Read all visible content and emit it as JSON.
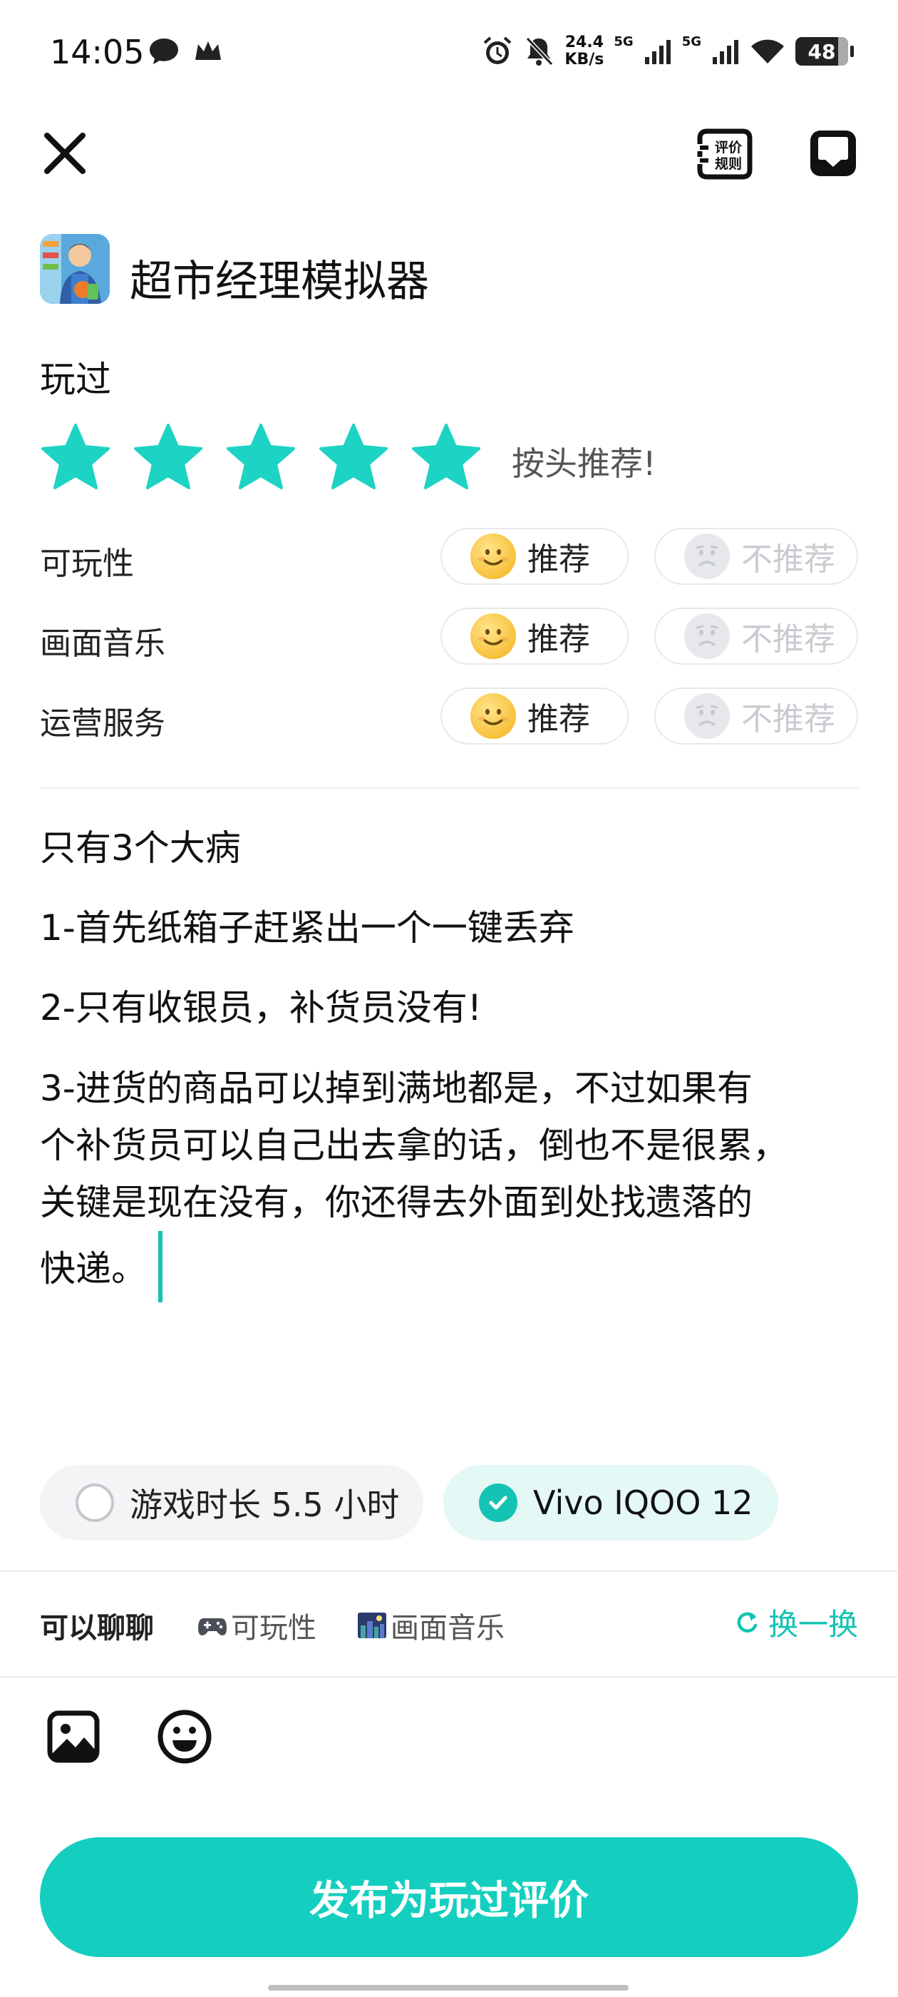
{
  "status_bar": {
    "time": "14:05",
    "net_speed_top": "24.4",
    "net_speed_bottom": "KB/s",
    "sim1": "5G",
    "sim2": "5G",
    "battery": "48"
  },
  "header": {
    "rules_label_line1": "评价",
    "rules_label_line2": "规则"
  },
  "game": {
    "title": "超市经理模拟器"
  },
  "status_label": "玩过",
  "stars": {
    "filled": 5,
    "total": 5,
    "text": "按头推荐!"
  },
  "ratings": [
    {
      "label": "可玩性",
      "recommend": "推荐",
      "not_recommend": "不推荐"
    },
    {
      "label": "画面音乐",
      "recommend": "推荐",
      "not_recommend": "不推荐"
    },
    {
      "label": "运营服务",
      "recommend": "推荐",
      "not_recommend": "不推荐"
    }
  ],
  "review": {
    "line1": "只有3个大病",
    "line2": "1-首先纸箱子赶紧出一个一键丢弃",
    "line3": "2-只有收银员，补货员没有!",
    "line4a": "3-进货的商品可以掉到满地都是，不过如果有",
    "line4b": "个补货员可以自己出去拿的话，倒也不是很累，",
    "line4c": "关键是现在没有，你还得去外面到处找遗落的",
    "line4d": "快递。"
  },
  "tags": {
    "playtime": "游戏时长 5.5 小时",
    "device": "Vivo IQOO 12"
  },
  "topics": {
    "lead": "可以聊聊",
    "items": [
      "可玩性",
      "画面音乐"
    ],
    "refresh": "换一换"
  },
  "publish_label": "发布为玩过评价",
  "colors": {
    "accent": "#14CFBF",
    "star": "#1DD3C4",
    "text": "#111111"
  }
}
